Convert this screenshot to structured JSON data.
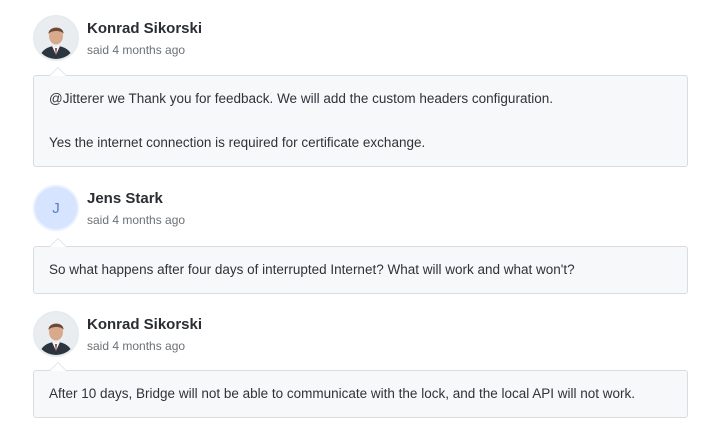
{
  "comments": [
    {
      "author": "Konrad Sikorski",
      "meta": "said 4 months ago",
      "avatar": "photo",
      "paragraphs": [
        "@Jitterer we Thank you for feedback. We will add the custom headers configuration.",
        "Yes the internet connection is required for certificate exchange."
      ]
    },
    {
      "author": "Jens Stark",
      "meta": "said 4 months ago",
      "avatar": "initial",
      "initial": "J",
      "paragraphs": [
        "So what happens after four days of interrupted Internet? What will work and what won't?"
      ]
    },
    {
      "author": "Konrad Sikorski",
      "meta": "said 4 months ago",
      "avatar": "photo",
      "paragraphs": [
        "After 10 days, Bridge will not be able to communicate with the lock, and the local API will not work."
      ]
    }
  ],
  "colors": {
    "bubble_bg": "#f7f8f9",
    "bubble_border": "#d8dde1",
    "initial_avatar_bg": "#d6e4ff",
    "initial_avatar_text": "#5a7dc4"
  }
}
